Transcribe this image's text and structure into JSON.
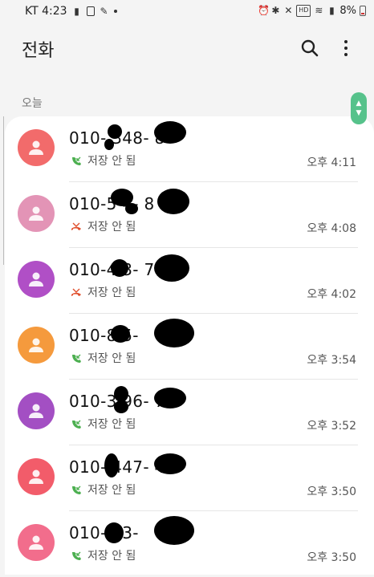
{
  "status_bar": {
    "carrier_time": "KT 4:23",
    "battery": "8%"
  },
  "app_bar": {
    "title": "전화"
  },
  "section": {
    "label": "오늘"
  },
  "calls": [
    {
      "number": "010-  348-   8",
      "status": "저장 안 됨",
      "time": "오후 4:11",
      "call_type": "incoming",
      "avatar_color": "#f26b6b"
    },
    {
      "number": "010-5  4-   8",
      "status": "저장 안 됨",
      "time": "오후 4:08",
      "call_type": "missed",
      "avatar_color": "#e394b6"
    },
    {
      "number": "010-4  3-   7",
      "status": "저장 안 됨",
      "time": "오후 4:02",
      "call_type": "missed",
      "avatar_color": "#b04fc6"
    },
    {
      "number": "010-8  5-",
      "status": "저장 안 됨",
      "time": "오후 3:54",
      "call_type": "incoming",
      "avatar_color": "#f59a3d"
    },
    {
      "number": "010-3  96-   7",
      "status": "저장 안 됨",
      "time": "오후 3:52",
      "call_type": "incoming",
      "avatar_color": "#a34fc3"
    },
    {
      "number": "010-  447-   4",
      "status": "저장 안 됨",
      "time": "오후 3:50",
      "call_type": "incoming",
      "avatar_color": "#f25c6a"
    },
    {
      "number": "010-  03-",
      "status": "저장 안 됨",
      "time": "오후 3:50",
      "call_type": "incoming",
      "avatar_color": "#f26d8c"
    }
  ],
  "icons": {
    "incoming_color": "#4caf50",
    "missed_color": "#e0502e"
  }
}
